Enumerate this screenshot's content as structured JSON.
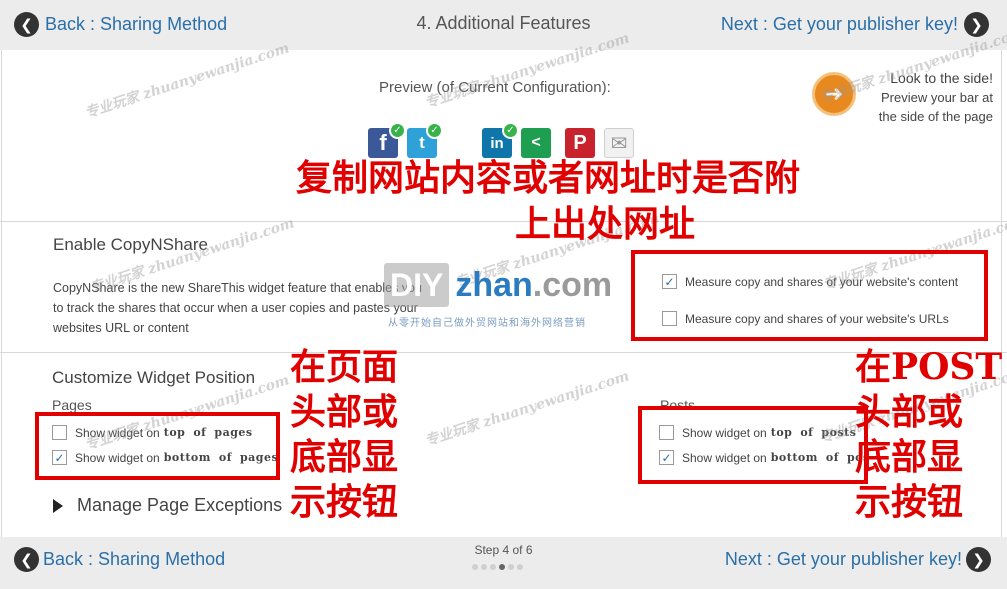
{
  "nav": {
    "back_label": "Back : Sharing Method",
    "next_label": "Next : Get your publisher key!",
    "step_title": "4. Additional Features",
    "step_counter": "Step 4 of 6",
    "total_steps": 6,
    "current_step": 4
  },
  "preview": {
    "label": "Preview (of Current Configuration):",
    "side_note": [
      "Look to the side!",
      "Preview your bar at",
      "the side of the page"
    ],
    "icons": [
      "facebook-icon",
      "twitter-icon",
      "linkedin-icon",
      "sharethis-icon",
      "pinterest-icon",
      "email-icon"
    ],
    "checked": [
      "facebook",
      "twitter",
      "linkedin"
    ]
  },
  "copynshare": {
    "title": "Enable CopyNShare",
    "description": "CopyNShare is the new ShareThis widget feature that enables you to track the shares that occur when a user copies and pastes your websites URL or content",
    "options": [
      {
        "label": "Measure copy and shares of your website's content",
        "checked": true
      },
      {
        "label": "Measure copy and shares of your website's URLs",
        "checked": false
      }
    ]
  },
  "widget_position": {
    "title": "Customize Widget Position",
    "pages_label": "Pages",
    "posts_label": "Posts",
    "pages_options": [
      {
        "prefix": "Show widget on",
        "w1": "top",
        "w2": "of",
        "w3": "pages",
        "checked": false
      },
      {
        "prefix": "Show widget on",
        "w1": "bottom",
        "w2": "of",
        "w3": "pages",
        "checked": true
      }
    ],
    "posts_options": [
      {
        "prefix": "Show widget on",
        "w1": "top",
        "w2": "of",
        "w3": "posts",
        "checked": false
      },
      {
        "prefix": "Show widget on",
        "w1": "bottom",
        "w2": "of",
        "w3": "pos",
        "checked": true
      }
    ]
  },
  "manage": {
    "label": "Manage Page Exceptions"
  },
  "annotations": {
    "copy_note": [
      "复制网站内容或者网址时是否附",
      "上出处网址"
    ],
    "page_note": [
      "在页面",
      "头部或",
      "底部显",
      "示按钮"
    ],
    "post_note": [
      "在POST",
      "头部或",
      "底部显",
      "示按钮"
    ]
  },
  "watermarks": {
    "text_cn": "专业玩家",
    "text_en": "zhuanyewanjia.com",
    "logo_diy": "DIY",
    "logo_zhan": "zhan",
    "logo_com": ".com",
    "logo_slogan": "从零开始自己做外贸网站和海外网络营销"
  },
  "colors": {
    "annotation_red": "#e10000",
    "link_blue": "#2a6fa8",
    "check_green": "#37b34a",
    "badge_orange": "#e8891f"
  }
}
